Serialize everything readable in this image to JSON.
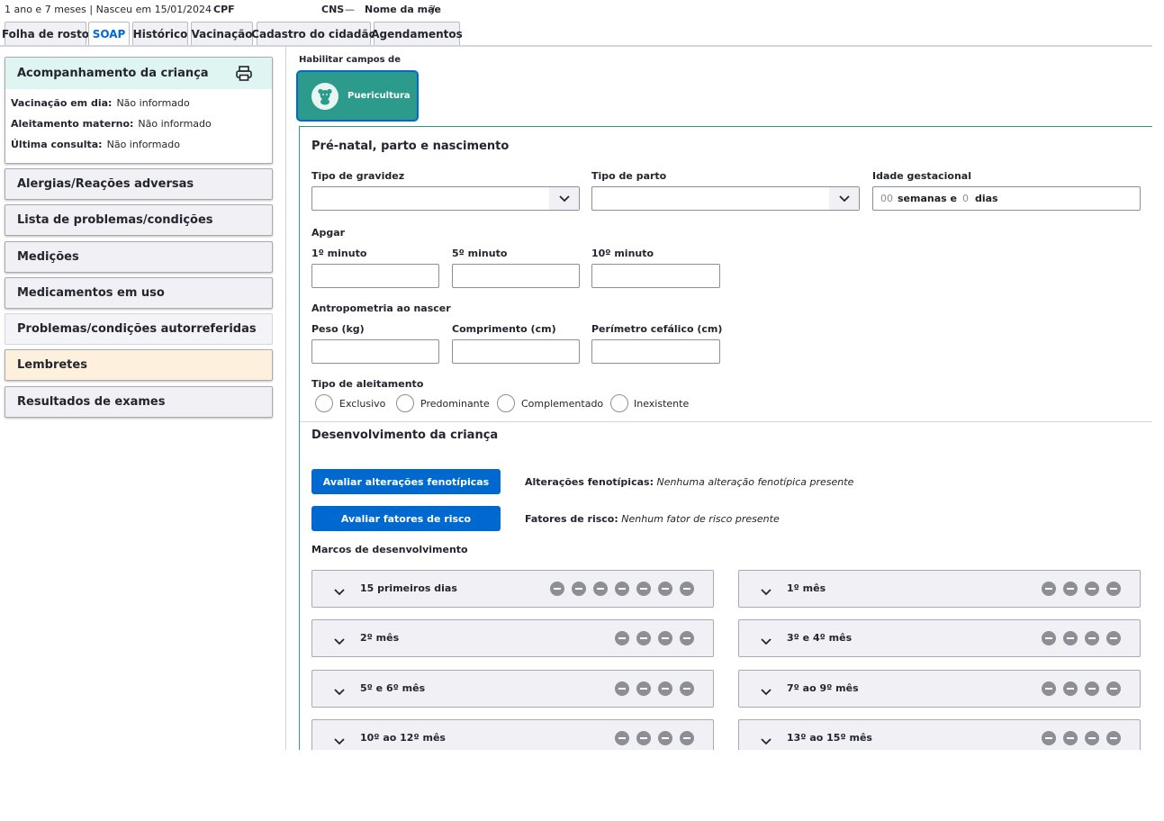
{
  "patient": {
    "age_birth": "1 ano e 7 meses | Nasceu em 15/01/2024",
    "cpf_label": "CPF",
    "cns_label": "CNS",
    "cns_value": "—",
    "mother_label": "Nome da mãe",
    "mother_value": "J"
  },
  "tabs": [
    "Folha de rosto",
    "SOAP",
    "Histórico",
    "Vacinação",
    "Cadastro do cidadão",
    "Agendamentos"
  ],
  "active_tab": "SOAP",
  "sidebar": {
    "acompanhamento": {
      "title": "Acompanhamento da criança",
      "rows": [
        {
          "key": "Vacinação em dia:",
          "value": "Não informado"
        },
        {
          "key": "Aleitamento materno:",
          "value": "Não informado"
        },
        {
          "key": "Última consulta:",
          "value": "Não informado"
        }
      ]
    },
    "items": [
      "Alergias/Reações adversas",
      "Lista de problemas/condições",
      "Medições",
      "Medicamentos em uso",
      "Problemas/condições autorreferidas",
      "Lembretes",
      "Resultados de exames"
    ]
  },
  "habilitar": {
    "label": "Habilitar campos de",
    "button": "Puericultura"
  },
  "prenatal": {
    "title": "Pré-natal, parto e nascimento",
    "tipo_gravidez": "Tipo de gravidez",
    "tipo_parto": "Tipo de parto",
    "idade_gestacional": "Idade gestacional",
    "semanas_placeholder": "00",
    "semanas_label": "semanas e",
    "dias_placeholder": "0",
    "dias_label": "dias",
    "apgar": "Apgar",
    "apgar_1": "1º minuto",
    "apgar_5": "5º minuto",
    "apgar_10": "10º minuto",
    "antropometria": "Antropometria ao nascer",
    "peso": "Peso (kg)",
    "comprimento": "Comprimento (cm)",
    "perimetro": "Perímetro cefálico (cm)",
    "aleitamento": "Tipo de aleitamento",
    "aleitamento_options": [
      "Exclusivo",
      "Predominante",
      "Complementado",
      "Inexistente"
    ]
  },
  "desenvolvimento": {
    "title": "Desenvolvimento da criança",
    "btn_fenotipicas": "Avaliar alterações fenotípicas",
    "fenotipicas_key": "Alterações fenotípicas:",
    "fenotipicas_value": "Nenhuma alteração fenotípica presente",
    "btn_risco": "Avaliar fatores de risco",
    "risco_key": "Fatores de risco:",
    "risco_value": "Nenhum fator de risco presente",
    "marcos_title": "Marcos de desenvolvimento",
    "marcos": [
      {
        "label": "15 primeiros dias",
        "count": 7
      },
      {
        "label": "1º mês",
        "count": 4
      },
      {
        "label": "2º mês",
        "count": 4
      },
      {
        "label": "3º e 4º mês",
        "count": 4
      },
      {
        "label": "5º e 6º mês",
        "count": 4
      },
      {
        "label": "7º ao 9º mês",
        "count": 4
      },
      {
        "label": "10º ao 12º mês",
        "count": 4
      },
      {
        "label": "13º ao 15º mês",
        "count": 4
      }
    ]
  }
}
